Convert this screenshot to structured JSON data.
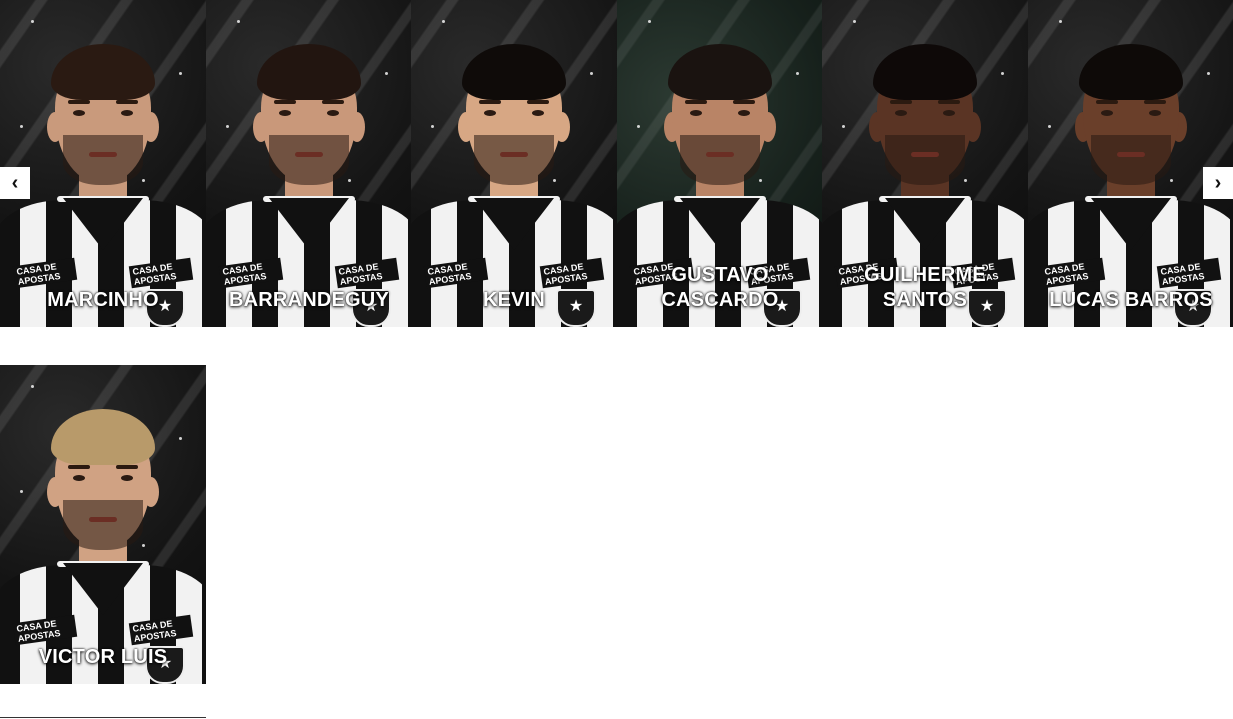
{
  "carousel": {
    "prev_arrow": "‹",
    "next_arrow": "›",
    "players": [
      {
        "name": "MARCINHO",
        "skin": "#c99a7c",
        "hair": "#2a1a12",
        "bg": "dark"
      },
      {
        "name": "BARRANDEGUY",
        "skin": "#c9987a",
        "hair": "#221510",
        "bg": "dark"
      },
      {
        "name": "KEVIN",
        "skin": "#d7a784",
        "hair": "#0f0b09",
        "bg": "dark"
      },
      {
        "name": "GUSTAVO CASCARDO",
        "skin": "#b98466",
        "hair": "#1a1310",
        "bg": "green"
      },
      {
        "name": "GUILHERME SANTOS",
        "skin": "#5a3424",
        "hair": "#0e0908",
        "bg": "dark"
      },
      {
        "name": "LUCAS BARROS",
        "skin": "#6a3f2a",
        "hair": "#0e0a08",
        "bg": "dark"
      }
    ]
  },
  "featured": {
    "name": "VICTOR LUIS",
    "skin": "#d0a283",
    "hair": "#b89a6a",
    "bg": "dark"
  },
  "sponsor_text": "CASA DE APOSTAS",
  "badge_icon": "★",
  "colors": {
    "accent": "#ffffff",
    "shirt_dark": "#111111",
    "shirt_light": "#f2f2f2"
  }
}
